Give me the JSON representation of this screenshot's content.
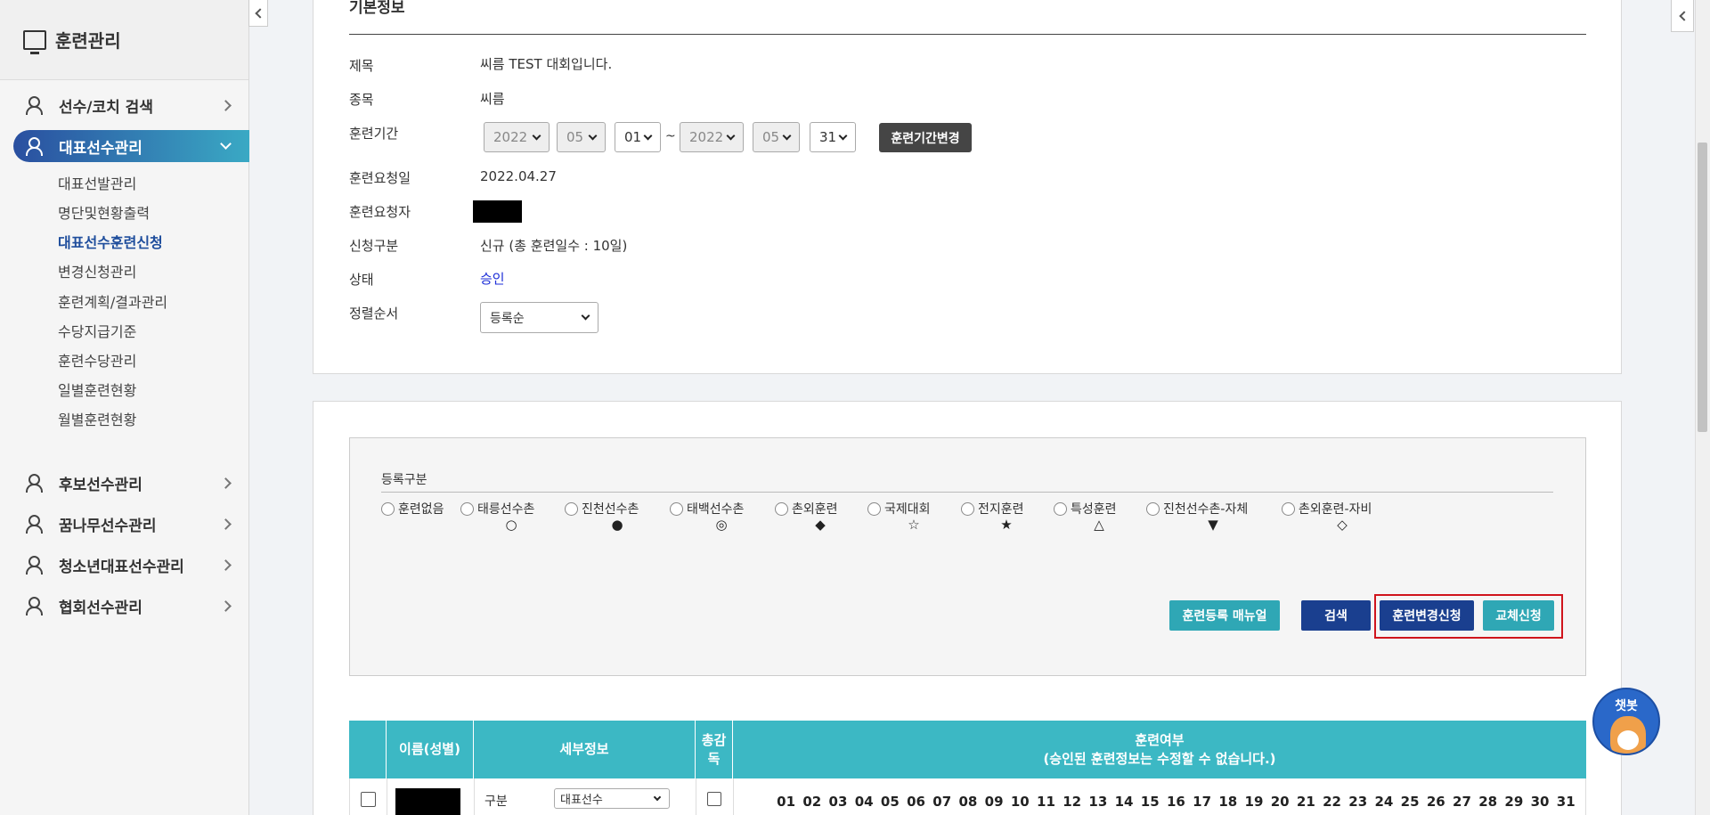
{
  "sidebar": {
    "title": "훈련관리",
    "nav": [
      {
        "label": "선수/코치 검색"
      },
      {
        "label": "대표선수관리"
      },
      {
        "label": "후보선수관리"
      },
      {
        "label": "꿈나무선수관리"
      },
      {
        "label": "청소년대표선수관리"
      },
      {
        "label": "협회선수관리"
      }
    ],
    "sub": [
      "대표선발관리",
      "명단및현황출력",
      "대표선수훈련신청",
      "변경신청관리",
      "훈련계획/결과관리",
      "수당지급기준",
      "훈련수당관리",
      "일별훈련현황",
      "월별훈련현황"
    ]
  },
  "info": {
    "section_title": "기본정보",
    "labels": {
      "title": "제목",
      "sport": "종목",
      "period": "훈련기간",
      "request_date": "훈련요청일",
      "requester": "훈련요청자",
      "type": "신청구분",
      "status": "상태",
      "sort": "정렬순서"
    },
    "values": {
      "title": "씨름 TEST 대회입니다.",
      "sport": "씨름",
      "request_date": "2022.04.27",
      "type": "신규 (총 훈련일수 : 10일)",
      "status": "승인",
      "sort": "등록순"
    },
    "period": {
      "start_year": "2022",
      "start_month": "05",
      "start_day": "01",
      "sep": "~",
      "end_year": "2022",
      "end_month": "05",
      "end_day": "31",
      "change_btn": "훈련기간변경"
    }
  },
  "filter": {
    "label": "등록구분",
    "options": [
      {
        "label": "훈련없음",
        "symbol": ""
      },
      {
        "label": "태릉선수촌",
        "symbol": "○"
      },
      {
        "label": "진천선수촌",
        "symbol": "●"
      },
      {
        "label": "태백선수촌",
        "symbol": "◎"
      },
      {
        "label": "촌외훈련",
        "symbol": "◆"
      },
      {
        "label": "국제대회",
        "symbol": "☆"
      },
      {
        "label": "전지훈련",
        "symbol": "★"
      },
      {
        "label": "특성훈련",
        "symbol": "△"
      },
      {
        "label": "진천선수촌-자체",
        "symbol": "▼"
      },
      {
        "label": "촌외훈련-자비",
        "symbol": "◇"
      }
    ],
    "buttons": {
      "manual": "훈련등록 매뉴얼",
      "search": "검색",
      "change_request": "훈련변경신청",
      "replace_request": "교체신청"
    }
  },
  "table": {
    "headers": {
      "name": "이름(성별)",
      "detail": "세부정보",
      "supervisor": "총감독",
      "training": "훈련여부",
      "training_note": "(승인된 훈련정보는 수정할 수 없습니다.)"
    },
    "row": {
      "detail_label": "구분",
      "detail_value": "대표선수"
    },
    "days": [
      "01",
      "02",
      "03",
      "04",
      "05",
      "06",
      "07",
      "08",
      "09",
      "10",
      "11",
      "12",
      "13",
      "14",
      "15",
      "16",
      "17",
      "18",
      "19",
      "20",
      "21",
      "22",
      "23",
      "24",
      "25",
      "26",
      "27",
      "28",
      "29",
      "30",
      "31"
    ]
  },
  "chatbot": {
    "label": "챗봇"
  },
  "colors": {
    "accent": "#3cb8c4",
    "navy": "#1a3f8f",
    "status": "#1e2fd8",
    "highlight": "#d0141c"
  }
}
